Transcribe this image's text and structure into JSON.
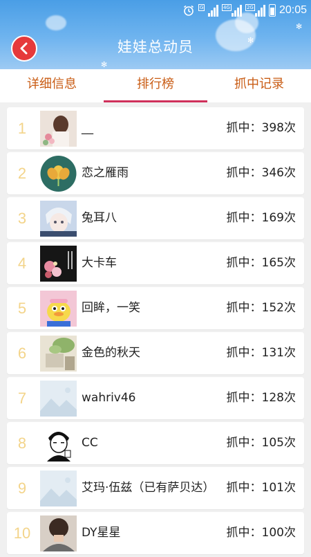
{
  "status": {
    "time": "20:05",
    "sim1": "G",
    "sim2": "4G",
    "sim2_sub": "2G"
  },
  "header": {
    "title": "娃娃总动员"
  },
  "tabs": [
    {
      "label": "详细信息",
      "active": false
    },
    {
      "label": "排行榜",
      "active": true
    },
    {
      "label": "抓中记录",
      "active": false
    }
  ],
  "ranking": [
    {
      "rank": "1",
      "name": "__",
      "count": "抓中：398次",
      "avatar": "girl-flowers-avatar"
    },
    {
      "rank": "2",
      "name": "恋之雁雨",
      "count": "抓中：346次",
      "avatar": "lotus-avatar"
    },
    {
      "rank": "3",
      "name": "兔耳八",
      "count": "抓中：169次",
      "avatar": "anime-boy-avatar"
    },
    {
      "rank": "4",
      "name": "大卡车",
      "count": "抓中：165次",
      "avatar": "dark-flowers-avatar"
    },
    {
      "rank": "5",
      "name": "回眸，一笑",
      "count": "抓中：152次",
      "avatar": "duck-avatar"
    },
    {
      "rank": "6",
      "name": "金色的秋天",
      "count": "抓中：131次",
      "avatar": "plant-avatar"
    },
    {
      "rank": "7",
      "name": "wahriv46",
      "count": "抓中：128次",
      "avatar": "placeholder-avatar"
    },
    {
      "rank": "8",
      "name": "CC",
      "count": "抓中：105次",
      "avatar": "cartoon-man-avatar"
    },
    {
      "rank": "9",
      "name": "艾玛·伍兹（已有萨贝达）",
      "count": "抓中：101次",
      "avatar": "placeholder-avatar"
    },
    {
      "rank": "10",
      "name": "DY星星",
      "count": "抓中：100次",
      "avatar": "person-back-avatar"
    }
  ],
  "colors": {
    "header_top": "#4a9ee6",
    "back_button": "#e6393b",
    "tab_text": "#c95c14",
    "tab_underline": "#d0305a",
    "rank_number": "#f3d48a"
  }
}
